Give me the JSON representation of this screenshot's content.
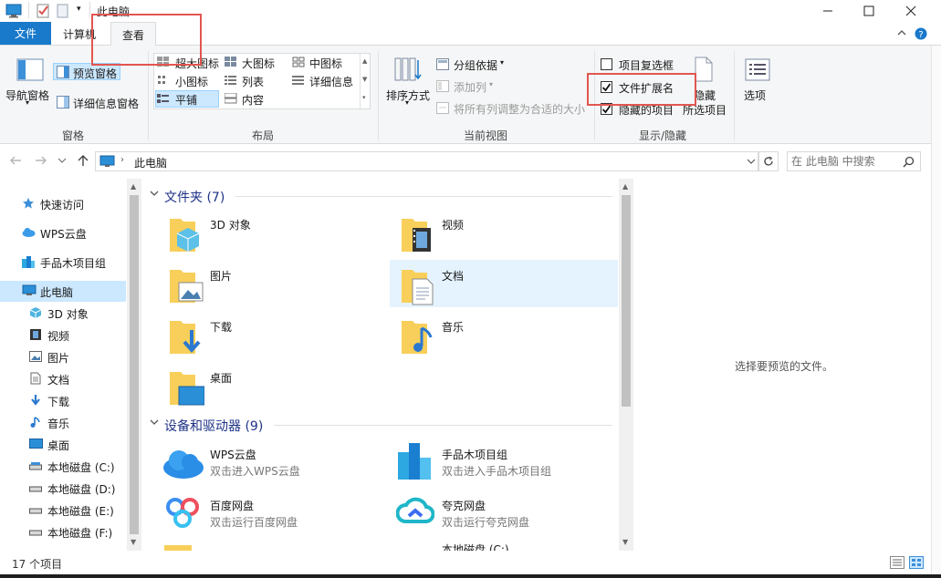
{
  "window": {
    "title": "此电脑"
  },
  "tabs": [
    {
      "label": "文件"
    },
    {
      "label": "计算机"
    },
    {
      "label": "查看"
    }
  ],
  "ribbon": {
    "panes": {
      "nav_pane": "导航窗格",
      "preview_pane": "预览窗格",
      "details_pane": "详细信息窗格",
      "group": "窗格"
    },
    "layout": {
      "items": [
        "超大图标",
        "大图标",
        "中图标",
        "小图标",
        "列表",
        "详细信息",
        "平铺",
        "内容"
      ],
      "group": "布局"
    },
    "current_view": {
      "sort_by": "排序方式",
      "group_by": "分组依据",
      "add_columns": "添加列",
      "fit_columns": "将所有列调整为合适的大小",
      "group": "当前视图"
    },
    "show_hide": {
      "item_checkboxes": "项目复选框",
      "file_extensions": "文件扩展名",
      "hidden_items": "隐藏的项目",
      "hide": "隐藏",
      "selected_items": "所选项目",
      "group": "显示/隐藏",
      "checked_item_checkboxes": false,
      "checked_file_extensions": true,
      "checked_hidden_items": true
    },
    "options": "选项"
  },
  "address": {
    "path": "此电脑",
    "search_placeholder": "在 此电脑 中搜索"
  },
  "nav": {
    "items": [
      "快速访问",
      "WPS云盘",
      "手品木项目组",
      "此电脑",
      "3D 对象",
      "视频",
      "图片",
      "文档",
      "下载",
      "音乐",
      "桌面",
      "本地磁盘 (C:)",
      "本地磁盘 (D:)",
      "本地磁盘 (E:)",
      "本地磁盘 (F:)"
    ]
  },
  "content": {
    "folders_header": "文件夹 (7)",
    "folders": [
      "3D 对象",
      "视频",
      "图片",
      "文档",
      "下载",
      "音乐",
      "桌面"
    ],
    "devices_header": "设备和驱动器 (9)",
    "devices": [
      {
        "name": "WPS云盘",
        "desc": "双击进入WPS云盘"
      },
      {
        "name": "手品木项目组",
        "desc": "双击进入手品木项目组"
      },
      {
        "name": "百度网盘",
        "desc": "双击运行百度网盘"
      },
      {
        "name": "夸克网盘",
        "desc": "双击运行夸克网盘"
      },
      {
        "name": "本地磁盘 (C:)",
        "desc": ""
      }
    ]
  },
  "preview": {
    "message": "选择要预览的文件。"
  },
  "status": {
    "count": "17 个项目"
  },
  "colors": {
    "accent": "#1979ca",
    "highlight_border": "#e25650",
    "selection": "#cce8ff",
    "header_blue": "#1e3287"
  }
}
